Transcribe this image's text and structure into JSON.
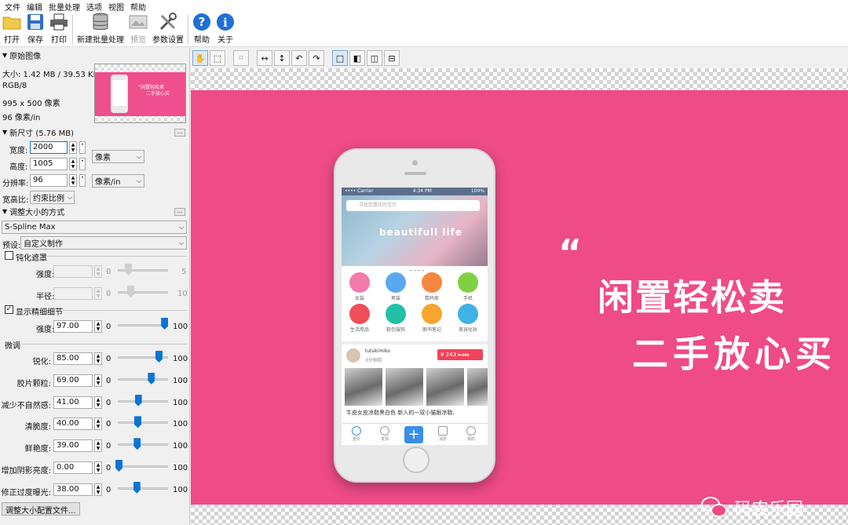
{
  "menu": [
    "文件",
    "编辑",
    "批量处理",
    "选项",
    "视图",
    "帮助"
  ],
  "toolbar": {
    "open": "打开",
    "save": "保存",
    "print": "打印",
    "batch": "新建批量处理",
    "preview": "预览",
    "settings": "参数设置",
    "help": "帮助",
    "about": "关于"
  },
  "original": {
    "header": "原始图像",
    "size": "大小: 1.42 MB / 39.53 KB",
    "mode": "RGB/8",
    "dims": "995 x 500 像素",
    "dpi": "96 像素/in",
    "thumb_text_1": "“闲置轻松卖",
    "thumb_text_2": "二手放心买"
  },
  "new_size": {
    "header": "新尺寸 (5.76 MB)",
    "width_label": "宽度:",
    "width_value": "2000",
    "height_label": "高度:",
    "height_value": "1005",
    "unit": "像素",
    "res_label": "分辨率:",
    "res_value": "96",
    "res_unit": "像素/in",
    "aspect_label": "宽高比:",
    "aspect_value": "约束比例",
    "more_btn": "..."
  },
  "method": {
    "header": "调整大小的方式",
    "more_btn": "...",
    "algorithm": "S-Spline Max",
    "preset_label": "预设:",
    "preset_value": "自定义制作"
  },
  "sharpen_mask": {
    "label": "钝化遮罩",
    "checked": false,
    "strength_label": "强度:",
    "radius_label": "半径:",
    "min": "0",
    "strength_max": "5",
    "radius_max": "10"
  },
  "detail": {
    "label": "显示精细细节",
    "checked": true,
    "check_mark": "✓",
    "strength_label": "强度:",
    "strength_value": "97.00",
    "strength_level": 0.97,
    "min": "0",
    "max": "100"
  },
  "fine_tune": {
    "header": "微调",
    "min": "0",
    "max": "100",
    "rows": [
      {
        "label": "锐化:",
        "value": "85.00",
        "level": 0.85
      },
      {
        "label": "胶片颗粒:",
        "value": "69.00",
        "level": 0.69
      },
      {
        "label": "减少不自然感:",
        "value": "41.00",
        "level": 0.41
      },
      {
        "label": "清脆度:",
        "value": "40.00",
        "level": 0.4
      },
      {
        "label": "鲜艳度:",
        "value": "39.00",
        "level": 0.39
      },
      {
        "label": "增加阴影亮度:",
        "value": "0.00",
        "level": 0.0
      },
      {
        "label": "修正过度曝光:",
        "value": "38.00",
        "level": 0.38
      }
    ]
  },
  "profile_button": "调整大小配置文件...",
  "view_tools": {
    "hand": "✋",
    "select": "⬚",
    "crop": "⌗",
    "flip_h": "↔",
    "flip_v": "↕",
    "rot_left": "↶",
    "rot_right": "↷",
    "single": "□",
    "split_v": "◧",
    "dual": "◫",
    "split_h": "⊟"
  },
  "preview": {
    "status_left": "•••• Carrier",
    "status_center": "4:34 PM",
    "status_right": "100%",
    "search_placeholder": "寻找您喜欢的宝贝",
    "banner_text": "beautifull life",
    "categories": [
      {
        "label": "女装",
        "color": "#f27bab"
      },
      {
        "label": "男装",
        "color": "#5aa9ef"
      },
      {
        "label": "数码家",
        "color": "#f7873e"
      },
      {
        "label": "手机",
        "color": "#7fd142"
      },
      {
        "label": "生活用品",
        "color": "#f04f5a"
      },
      {
        "label": "鞋包服饰",
        "color": "#22c1a7"
      },
      {
        "label": "图书笔记",
        "color": "#f8a530"
      },
      {
        "label": "美容化妆",
        "color": "#3fb2e6"
      }
    ],
    "user": "tutukimiko",
    "time": "3分钟前",
    "price": "¥ 243",
    "old_price": "¥ 390",
    "desc": "牛皮女皮凉鞋黑白色 新入的一双小猫跟凉鞋、",
    "tabs": [
      "首页",
      "发现",
      "",
      "消息",
      "我的"
    ],
    "tab_plus": "+",
    "quote": "“",
    "slogan_1": "闲置轻松卖",
    "slogan_2": "二手放心买",
    "watermark": "码农乐园"
  },
  "colors": {
    "pink": "#ee4b87",
    "accent": "#0a74d4"
  }
}
